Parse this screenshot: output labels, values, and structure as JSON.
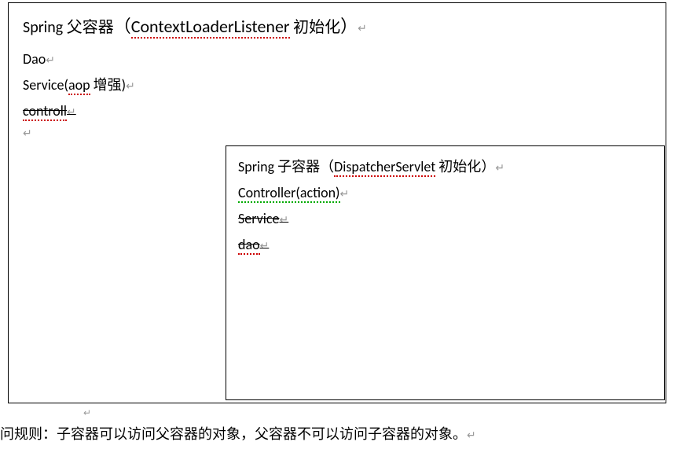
{
  "parent": {
    "title_prefix": "Spring 父容器",
    "title_paren_open": "（",
    "title_classname": "ContextLoaderListener",
    "title_suffix": " 初始化",
    "title_paren_close": "）",
    "items": {
      "dao": "Dao",
      "service_prefix": "Service(",
      "service_aop": "aop",
      "service_suffix": " 增强)",
      "controll": "controll"
    }
  },
  "child": {
    "title_prefix": "Spring 子容器",
    "title_paren_open": "（",
    "title_classname": "DispatcherServlet",
    "title_suffix": " 初始化",
    "title_paren_close": "）",
    "items": {
      "controller": "Controller(action)",
      "service": "Service",
      "dao": "dao"
    }
  },
  "bottom_rule": "问规则：子容器可以访问父容器的对象，父容器不可以访问子容器的对象。",
  "carriage": "↵"
}
